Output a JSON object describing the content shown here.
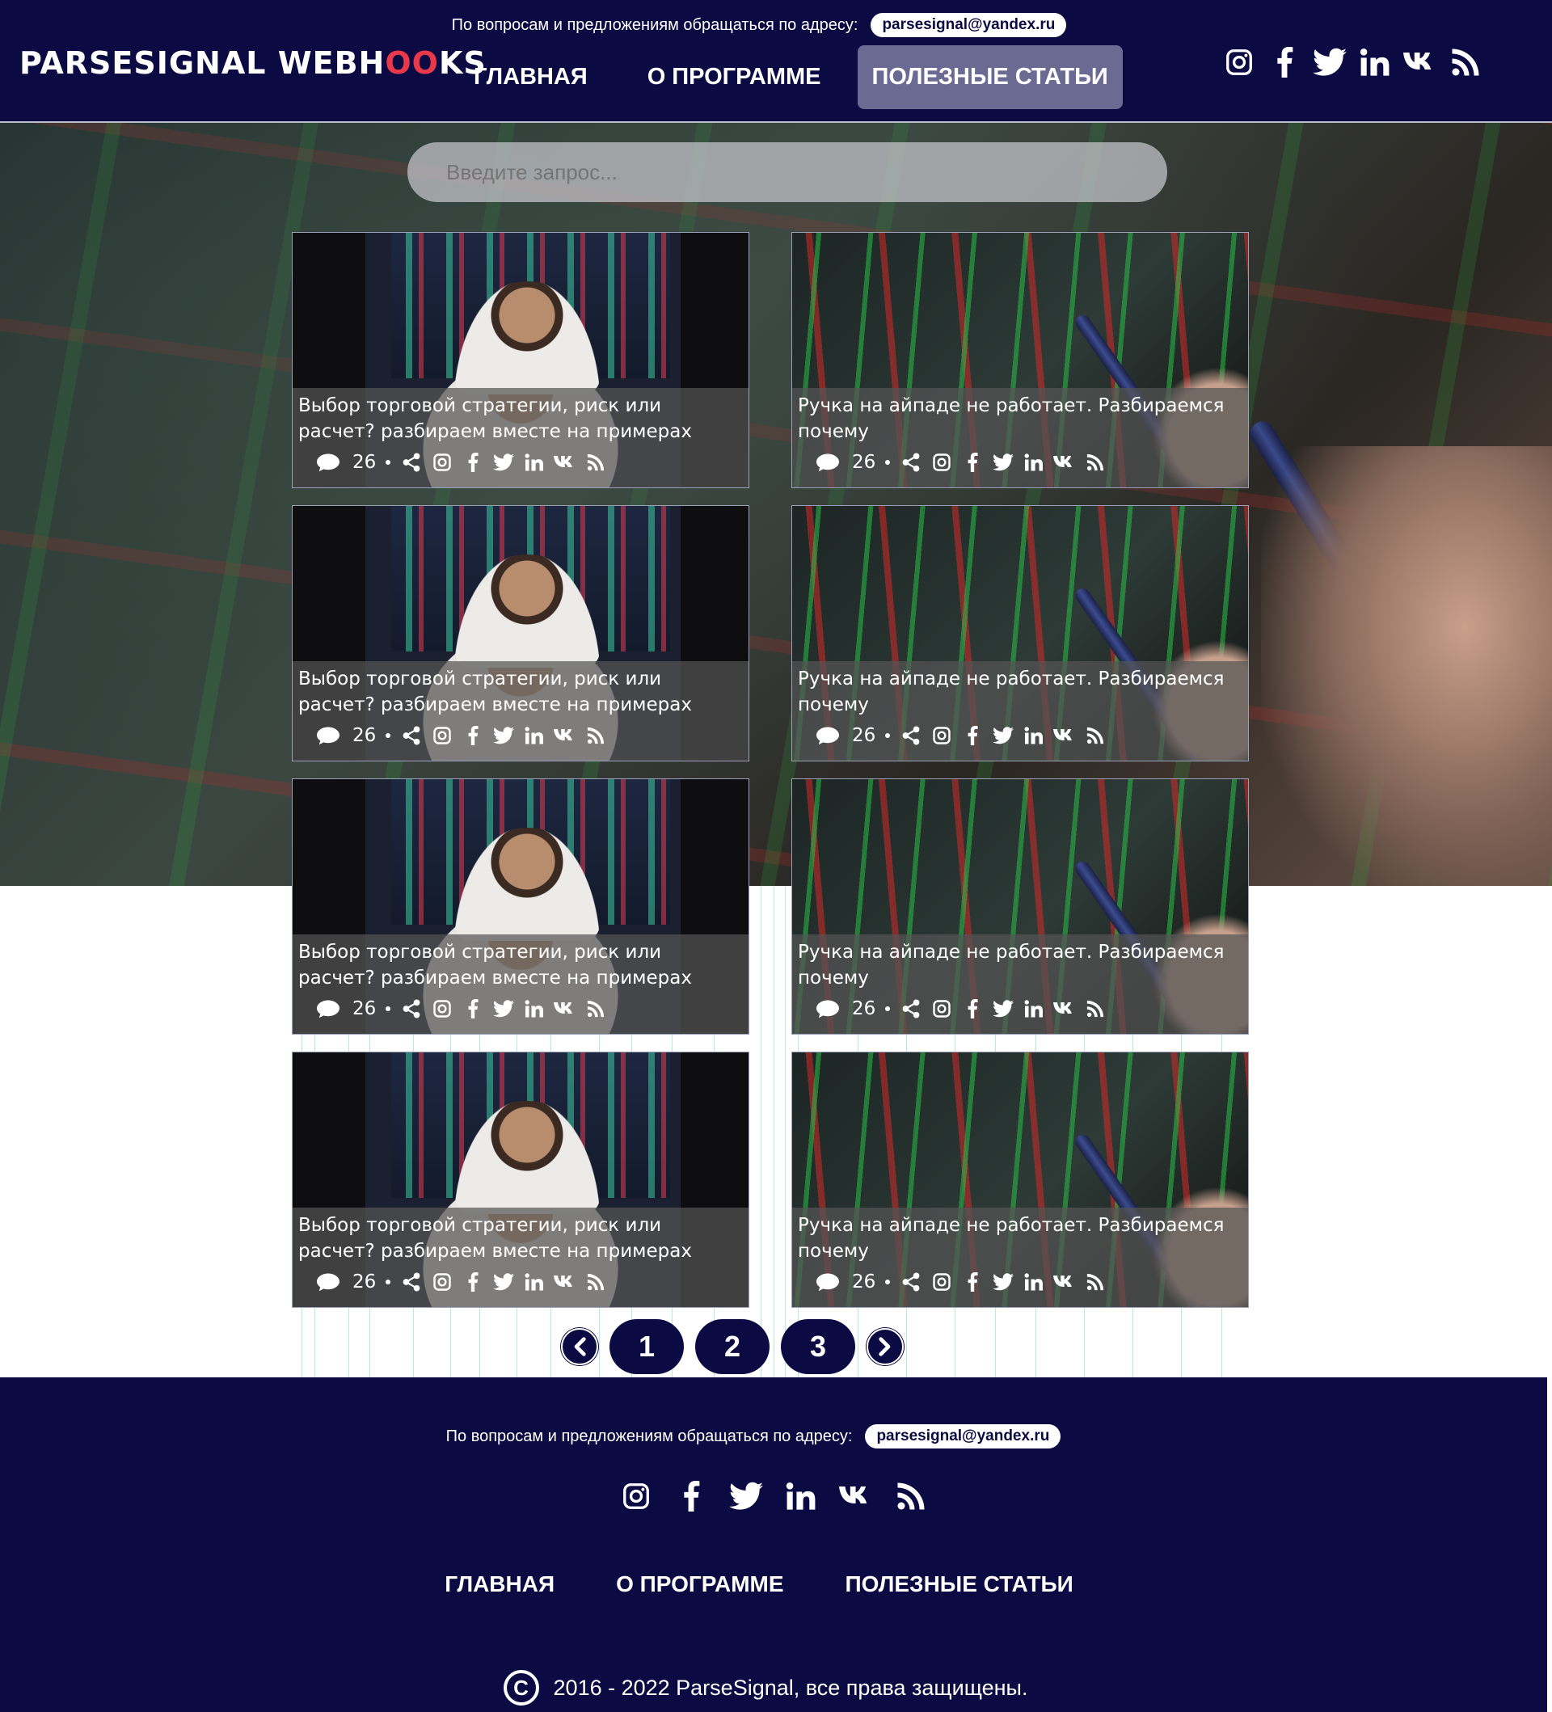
{
  "header": {
    "contact_text": "По вопросам и предложениям обращаться по адресу:",
    "email": "parsesignal@yandex.ru",
    "logo_part1": "PARSESIGNAL WEBH",
    "logo_oo": "OO",
    "logo_part2": "KS",
    "nav": [
      "ГЛАВНАЯ",
      "О ПРОГРАММЕ",
      "ПОЛЕЗНЫЕ СТАТЬИ"
    ],
    "active_nav": "ПОЛЕЗНЫЕ СТАТЬИ",
    "social": [
      "instagram-icon",
      "facebook-icon",
      "twitter-icon",
      "linkedin-icon",
      "vk-icon",
      "rss-icon"
    ]
  },
  "search": {
    "placeholder": "Введите запрос..."
  },
  "articles": [
    {
      "title": "Выбор торговой стратегии, риск или расчет? разбираем вместе на примерах",
      "comments": "26"
    },
    {
      "title": "Ручка на айпаде не работает. Разбираемся почему",
      "comments": "26"
    },
    {
      "title": "Выбор торговой стратегии, риск или расчет? разбираем вместе на примерах",
      "comments": "26"
    },
    {
      "title": "Ручка на айпаде не работает. Разбираемся почему",
      "comments": "26"
    },
    {
      "title": "Выбор торговой стратегии, риск или расчет? разбираем вместе на примерах",
      "comments": "26"
    },
    {
      "title": "Ручка на айпаде не работает. Разбираемся почему",
      "comments": "26"
    },
    {
      "title": "Выбор торговой стратегии, риск или расчет? разбираем вместе на примерах",
      "comments": "26"
    },
    {
      "title": "Ручка на айпаде не работает. Разбираемся почему",
      "comments": "26"
    }
  ],
  "pagination": {
    "pages": [
      "1",
      "2",
      "3"
    ]
  },
  "footer": {
    "contact_text": "По вопросам и предложениям обращаться по адресу:",
    "email": "parsesignal@yandex.ru",
    "nav": [
      "ГЛАВНАЯ",
      "О ПРОГРАММЕ",
      "ПОЛЕЗНЫЕ СТАТЬИ"
    ],
    "copyright": "2016 - 2022 ParseSignal, все права защищены."
  },
  "colors": {
    "brand_navy": "#0b0a42",
    "active_nav_bg": "#6b6a93",
    "logo_accent": "#e8384a"
  }
}
